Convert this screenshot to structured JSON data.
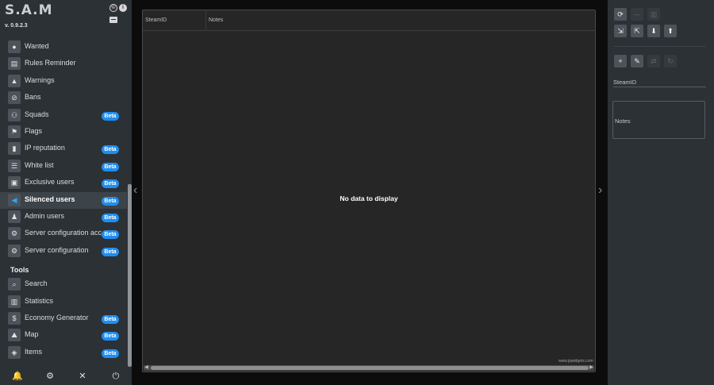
{
  "app": {
    "logo": "S.A.M",
    "version": "v. 0.9.2.3",
    "copyright_icon": "©",
    "info_icon": "i"
  },
  "menu": {
    "items": [
      {
        "label": "Wanted",
        "icon": "info-circle-icon",
        "glyph": "●",
        "beta": false
      },
      {
        "label": "Rules Reminder",
        "icon": "document-icon",
        "glyph": "▤",
        "beta": false
      },
      {
        "label": "Warnings",
        "icon": "warning-icon",
        "glyph": "▲",
        "beta": false
      },
      {
        "label": "Bans",
        "icon": "ban-user-icon",
        "glyph": "⊘",
        "beta": false
      },
      {
        "label": "Squads",
        "icon": "users-icon",
        "glyph": "⚇",
        "beta": true
      },
      {
        "label": "Flags",
        "icon": "flag-icon",
        "glyph": "⚑",
        "beta": false
      },
      {
        "label": "IP reputation",
        "icon": "ip-file-icon",
        "glyph": "▮",
        "beta": true
      },
      {
        "label": "White list",
        "icon": "list-icon",
        "glyph": "☰",
        "beta": true
      },
      {
        "label": "Exclusive users",
        "icon": "clipboard-icon",
        "glyph": "▣",
        "beta": true
      },
      {
        "label": "Silenced users",
        "icon": "mute-icon",
        "glyph": "◀",
        "beta": true,
        "active": true
      },
      {
        "label": "Admin users",
        "icon": "user-shield-icon",
        "glyph": "♟",
        "beta": true
      },
      {
        "label": "Server configuration acce",
        "icon": "user-gear-icon",
        "glyph": "⚙",
        "beta": true
      },
      {
        "label": "Server configuration",
        "icon": "gears-icon",
        "glyph": "⚙",
        "beta": true
      }
    ],
    "tools_title": "Tools",
    "tools": [
      {
        "label": "Search",
        "icon": "search-icon",
        "glyph": "⌕",
        "beta": false
      },
      {
        "label": "Statistics",
        "icon": "chart-icon",
        "glyph": "▥",
        "beta": false
      },
      {
        "label": "Economy Generator",
        "icon": "economy-icon",
        "glyph": "$",
        "beta": true
      },
      {
        "label": "Map",
        "icon": "map-icon",
        "glyph": "⛰",
        "beta": true
      },
      {
        "label": "Items",
        "icon": "box-icon",
        "glyph": "◈",
        "beta": true
      }
    ],
    "beta_label": "Beta"
  },
  "footer": {
    "bell": "🔔",
    "gear": "⚙",
    "tools": "✕",
    "power": "⏻"
  },
  "grid": {
    "columns": [
      "SteamID",
      "Notes"
    ],
    "empty_text": "No data to display",
    "watermark": "www.jqwidgets.com"
  },
  "right_panel": {
    "toolbar_row1": [
      {
        "name": "refresh-button",
        "glyph": "⟳",
        "enabled": true
      },
      {
        "name": "remove-button",
        "glyph": "—",
        "enabled": false
      },
      {
        "name": "delete-button",
        "glyph": "▥",
        "enabled": false
      }
    ],
    "toolbar_row2": [
      {
        "name": "import-button",
        "glyph": "⇲",
        "enabled": true
      },
      {
        "name": "export-button",
        "glyph": "⇱",
        "enabled": true
      },
      {
        "name": "download-button",
        "glyph": "⬇",
        "enabled": true
      },
      {
        "name": "upload-button",
        "glyph": "⬆",
        "enabled": true
      }
    ],
    "toolbar_row3": [
      {
        "name": "add-button",
        "glyph": "+",
        "enabled": true
      },
      {
        "name": "edit-button",
        "glyph": "✎",
        "enabled": true
      },
      {
        "name": "repeat-button",
        "glyph": "⇄",
        "enabled": false
      },
      {
        "name": "redo-button",
        "glyph": "↻",
        "enabled": false
      }
    ],
    "steamid_label": "SteamID",
    "notes_label": "Notes"
  }
}
